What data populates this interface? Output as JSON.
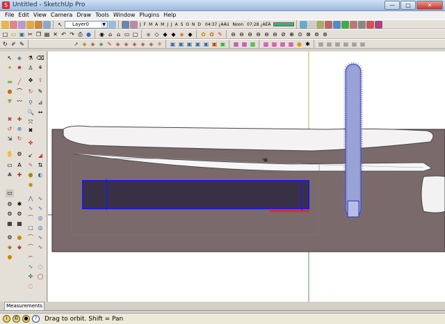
{
  "window": {
    "title": "Untitled - SketchUp Pro",
    "minimize": "—",
    "maximize": "□",
    "close": "✕"
  },
  "menu": [
    "File",
    "Edit",
    "View",
    "Camera",
    "Draw",
    "Tools",
    "Window",
    "Plugins",
    "Help"
  ],
  "toolbar": {
    "layer_value": "Layer0",
    "shadow_months": "J F M A M J J A S O N D",
    "time_start": "04:37 ¿ÀÀü",
    "time_noon": "Noon",
    "time_end": "07:28 ¿ÀÈÄ"
  },
  "icons": {
    "row1": [
      "select-icon",
      "eraser-icon",
      "paint-icon",
      "orbit-icon",
      "pan-icon",
      "zoom-icon",
      "layer-icon",
      "shadow-icon",
      "fog-icon"
    ],
    "row2": [
      "new-icon",
      "open-icon",
      "save-icon",
      "cut-icon",
      "copy-icon",
      "paste-icon",
      "delete-icon",
      "undo-icon",
      "redo-icon",
      "print-icon",
      "model-info-icon"
    ],
    "palette": [
      "select-icon",
      "make-component-icon",
      "paint-bucket-icon",
      "eraser-icon",
      "rectangle-icon",
      "line-icon",
      "circle-icon",
      "arc-icon",
      "polygon-icon",
      "freehand-icon",
      "move-icon",
      "push-pull-icon",
      "rotate-icon",
      "follow-me-icon",
      "scale-icon",
      "offset-icon",
      "tape-measure-icon",
      "dimension-icon",
      "protractor-icon",
      "text-icon",
      "axes-icon",
      "3d-text-icon",
      "orbit-icon",
      "pan-icon",
      "zoom-icon",
      "zoom-window-icon",
      "zoom-extents-icon",
      "previous-view-icon",
      "position-camera-icon",
      "walk-icon",
      "look-around-icon",
      "section-plane-icon"
    ]
  },
  "colors": {
    "titlebar": "#9cbbe0",
    "viewport_bg": "#ffffff",
    "plank": "#7a6a6c",
    "selection": "#1c1cd6",
    "axis_green": "#4aa04a",
    "axis_red": "#d23030",
    "axis_blue": "#3050d0"
  },
  "status": {
    "measurements_label": "Measurements",
    "message": "Drag to orbit.  Shift = Pan",
    "help_icon": "?"
  }
}
